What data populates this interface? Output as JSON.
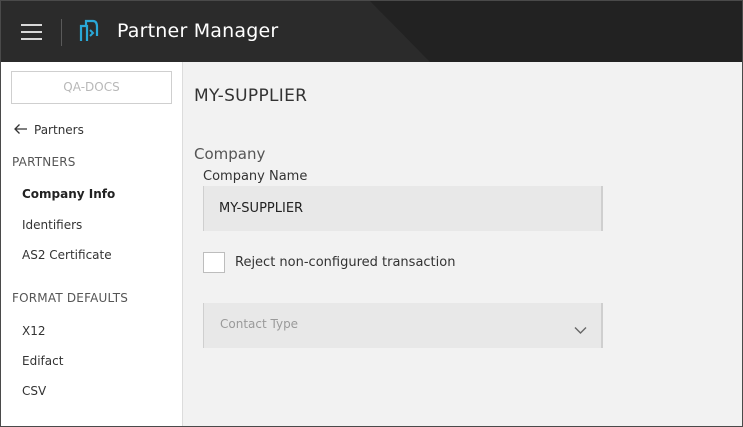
{
  "header": {
    "app_title": "Partner Manager",
    "menu_icon": "hamburger-menu-icon",
    "logo_icon": "partner-manager-logo",
    "colors": {
      "bar": "#2b2b2b",
      "logo": "#2aa8d8"
    }
  },
  "sidebar": {
    "org_selector": "QA-DOCS",
    "back_link": {
      "icon": "arrow-left-icon",
      "label": "Partners"
    },
    "partners_section": {
      "label": "PARTNERS",
      "items": [
        {
          "label": "Company Info",
          "active": true
        },
        {
          "label": "Identifiers",
          "active": false
        },
        {
          "label": "AS2 Certificate",
          "active": false
        }
      ]
    },
    "format_defaults_section": {
      "label": "FORMAT DEFAULTS",
      "items": [
        {
          "label": "X12"
        },
        {
          "label": "Edifact"
        },
        {
          "label": "CSV"
        }
      ]
    }
  },
  "main": {
    "page_title": "MY-SUPPLIER",
    "section_title": "Company",
    "company_name": {
      "label": "Company Name",
      "value": "MY-SUPPLIER"
    },
    "reject_checkbox": {
      "label": "Reject non-configured transaction",
      "checked": false
    },
    "contact_type": {
      "placeholder": "Contact Type",
      "icon": "chevron-down-icon"
    }
  }
}
